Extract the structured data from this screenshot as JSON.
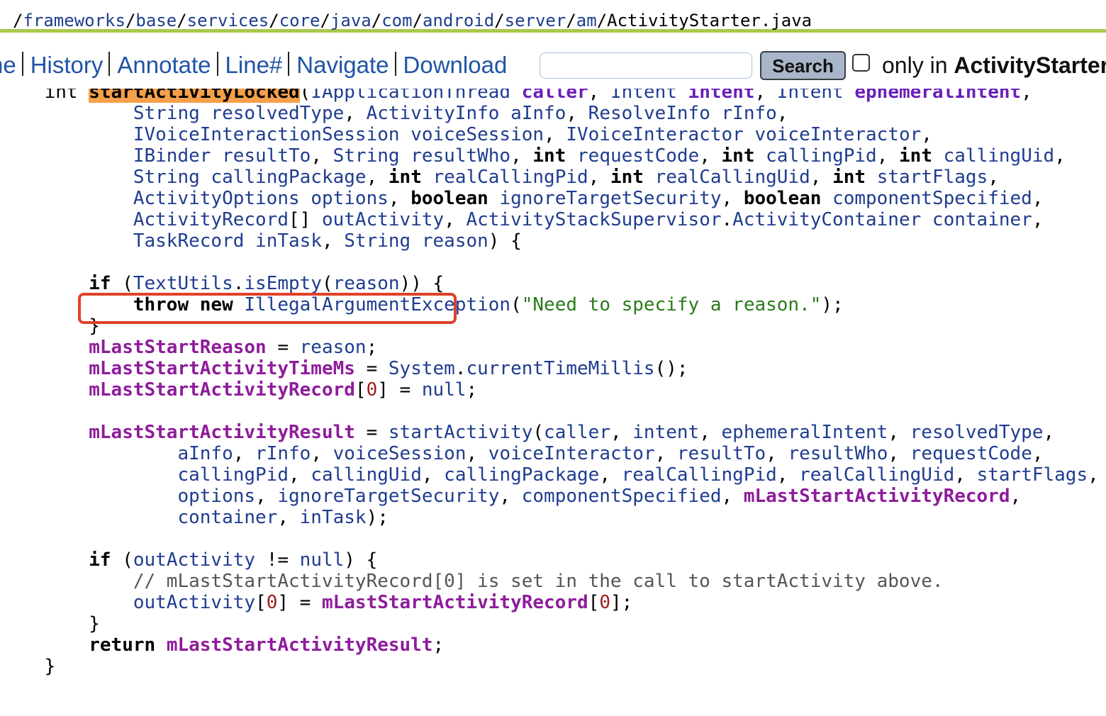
{
  "path": {
    "prefix": "/",
    "segments": [
      "frameworks",
      "base",
      "services",
      "core",
      "java",
      "com",
      "android",
      "server",
      "am"
    ],
    "separator": "/",
    "filename": "ActivityStarter.java"
  },
  "nav": {
    "links": [
      "ne",
      "History",
      "Annotate",
      "Line#",
      "Navigate",
      "Download"
    ],
    "search_placeholder": "",
    "search_button": "Search",
    "only_in_prefix": "only in ",
    "only_in_file": "ActivityStarter"
  },
  "highlight": {
    "border_color": "#e0412a",
    "symbol_bg": "#f5a04b"
  },
  "code": [
    [
      [
        "t",
        "    int "
      ],
      [
        "hl",
        "startActivityLocked"
      ],
      [
        "t",
        "("
      ],
      [
        "typ",
        "IApplicationThread"
      ],
      [
        "t",
        " "
      ],
      [
        "par",
        "caller"
      ],
      [
        "t",
        ", "
      ],
      [
        "typ",
        "Intent"
      ],
      [
        "t",
        " "
      ],
      [
        "par",
        "intent"
      ],
      [
        "t",
        ", "
      ],
      [
        "typ",
        "Intent"
      ],
      [
        "t",
        " "
      ],
      [
        "par",
        "ephemeralIntent"
      ],
      [
        "t",
        ","
      ]
    ],
    [
      [
        "t",
        "            "
      ],
      [
        "typ",
        "String"
      ],
      [
        "t",
        " "
      ],
      [
        "id",
        "resolvedType"
      ],
      [
        "t",
        ", "
      ],
      [
        "typ",
        "ActivityInfo"
      ],
      [
        "t",
        " "
      ],
      [
        "id",
        "aInfo"
      ],
      [
        "t",
        ", "
      ],
      [
        "typ",
        "ResolveInfo"
      ],
      [
        "t",
        " "
      ],
      [
        "id",
        "rInfo"
      ],
      [
        "t",
        ","
      ]
    ],
    [
      [
        "t",
        "            "
      ],
      [
        "typ",
        "IVoiceInteractionSession"
      ],
      [
        "t",
        " "
      ],
      [
        "id",
        "voiceSession"
      ],
      [
        "t",
        ", "
      ],
      [
        "typ",
        "IVoiceInteractor"
      ],
      [
        "t",
        " "
      ],
      [
        "id",
        "voiceInteractor"
      ],
      [
        "t",
        ","
      ]
    ],
    [
      [
        "t",
        "            "
      ],
      [
        "typ",
        "IBinder"
      ],
      [
        "t",
        " "
      ],
      [
        "id",
        "resultTo"
      ],
      [
        "t",
        ", "
      ],
      [
        "typ",
        "String"
      ],
      [
        "t",
        " "
      ],
      [
        "id",
        "resultWho"
      ],
      [
        "t",
        ", "
      ],
      [
        "kw",
        "int"
      ],
      [
        "t",
        " "
      ],
      [
        "id",
        "requestCode"
      ],
      [
        "t",
        ", "
      ],
      [
        "kw",
        "int"
      ],
      [
        "t",
        " "
      ],
      [
        "id",
        "callingPid"
      ],
      [
        "t",
        ", "
      ],
      [
        "kw",
        "int"
      ],
      [
        "t",
        " "
      ],
      [
        "id",
        "callingUid"
      ],
      [
        "t",
        ","
      ]
    ],
    [
      [
        "t",
        "            "
      ],
      [
        "typ",
        "String"
      ],
      [
        "t",
        " "
      ],
      [
        "id",
        "callingPackage"
      ],
      [
        "t",
        ", "
      ],
      [
        "kw",
        "int"
      ],
      [
        "t",
        " "
      ],
      [
        "id",
        "realCallingPid"
      ],
      [
        "t",
        ", "
      ],
      [
        "kw",
        "int"
      ],
      [
        "t",
        " "
      ],
      [
        "id",
        "realCallingUid"
      ],
      [
        "t",
        ", "
      ],
      [
        "kw",
        "int"
      ],
      [
        "t",
        " "
      ],
      [
        "id",
        "startFlags"
      ],
      [
        "t",
        ","
      ]
    ],
    [
      [
        "t",
        "            "
      ],
      [
        "typ",
        "ActivityOptions"
      ],
      [
        "t",
        " "
      ],
      [
        "id",
        "options"
      ],
      [
        "t",
        ", "
      ],
      [
        "kw",
        "boolean"
      ],
      [
        "t",
        " "
      ],
      [
        "id",
        "ignoreTargetSecurity"
      ],
      [
        "t",
        ", "
      ],
      [
        "kw",
        "boolean"
      ],
      [
        "t",
        " "
      ],
      [
        "id",
        "componentSpecified"
      ],
      [
        "t",
        ","
      ]
    ],
    [
      [
        "t",
        "            "
      ],
      [
        "typ",
        "ActivityRecord"
      ],
      [
        "t",
        "[] "
      ],
      [
        "id",
        "outActivity"
      ],
      [
        "t",
        ", "
      ],
      [
        "typ",
        "ActivityStackSupervisor"
      ],
      [
        "t",
        "."
      ],
      [
        "typ",
        "ActivityContainer"
      ],
      [
        "t",
        " "
      ],
      [
        "id",
        "container"
      ],
      [
        "t",
        ","
      ]
    ],
    [
      [
        "t",
        "            "
      ],
      [
        "typ",
        "TaskRecord"
      ],
      [
        "t",
        " "
      ],
      [
        "id",
        "inTask"
      ],
      [
        "t",
        ", "
      ],
      [
        "typ",
        "String"
      ],
      [
        "t",
        " "
      ],
      [
        "id",
        "reason"
      ],
      [
        "t",
        ") {"
      ]
    ],
    [],
    [
      [
        "t",
        "        "
      ],
      [
        "kw",
        "if"
      ],
      [
        "t",
        " ("
      ],
      [
        "typ",
        "TextUtils"
      ],
      [
        "t",
        "."
      ],
      [
        "id",
        "isEmpty"
      ],
      [
        "t",
        "("
      ],
      [
        "id",
        "reason"
      ],
      [
        "t",
        ")) {"
      ]
    ],
    [
      [
        "t",
        "            "
      ],
      [
        "kw",
        "throw"
      ],
      [
        "t",
        " "
      ],
      [
        "kw",
        "new"
      ],
      [
        "t",
        " "
      ],
      [
        "typ",
        "IllegalArgumentException"
      ],
      [
        "t",
        "("
      ],
      [
        "str",
        "\"Need to specify a reason.\""
      ],
      [
        "t",
        ");"
      ]
    ],
    [
      [
        "t",
        "        }"
      ]
    ],
    [
      [
        "t",
        "        "
      ],
      [
        "fld",
        "mLastStartReason"
      ],
      [
        "t",
        " = "
      ],
      [
        "id",
        "reason"
      ],
      [
        "t",
        ";"
      ]
    ],
    [
      [
        "t",
        "        "
      ],
      [
        "fld",
        "mLastStartActivityTimeMs"
      ],
      [
        "t",
        " = "
      ],
      [
        "typ",
        "System"
      ],
      [
        "t",
        "."
      ],
      [
        "id",
        "currentTimeMillis"
      ],
      [
        "t",
        "();"
      ]
    ],
    [
      [
        "t",
        "        "
      ],
      [
        "fld",
        "mLastStartActivityRecord"
      ],
      [
        "t",
        "["
      ],
      [
        "num",
        "0"
      ],
      [
        "t",
        "] = "
      ],
      [
        "id",
        "null"
      ],
      [
        "t",
        ";"
      ]
    ],
    [],
    [
      [
        "t",
        "        "
      ],
      [
        "fld",
        "mLastStartActivityResult"
      ],
      [
        "t",
        " = "
      ],
      [
        "id",
        "startActivity"
      ],
      [
        "t",
        "("
      ],
      [
        "id",
        "caller"
      ],
      [
        "t",
        ", "
      ],
      [
        "id",
        "intent"
      ],
      [
        "t",
        ", "
      ],
      [
        "id",
        "ephemeralIntent"
      ],
      [
        "t",
        ", "
      ],
      [
        "id",
        "resolvedType"
      ],
      [
        "t",
        ","
      ]
    ],
    [
      [
        "t",
        "                "
      ],
      [
        "id",
        "aInfo"
      ],
      [
        "t",
        ", "
      ],
      [
        "id",
        "rInfo"
      ],
      [
        "t",
        ", "
      ],
      [
        "id",
        "voiceSession"
      ],
      [
        "t",
        ", "
      ],
      [
        "id",
        "voiceInteractor"
      ],
      [
        "t",
        ", "
      ],
      [
        "id",
        "resultTo"
      ],
      [
        "t",
        ", "
      ],
      [
        "id",
        "resultWho"
      ],
      [
        "t",
        ", "
      ],
      [
        "id",
        "requestCode"
      ],
      [
        "t",
        ","
      ]
    ],
    [
      [
        "t",
        "                "
      ],
      [
        "id",
        "callingPid"
      ],
      [
        "t",
        ", "
      ],
      [
        "id",
        "callingUid"
      ],
      [
        "t",
        ", "
      ],
      [
        "id",
        "callingPackage"
      ],
      [
        "t",
        ", "
      ],
      [
        "id",
        "realCallingPid"
      ],
      [
        "t",
        ", "
      ],
      [
        "id",
        "realCallingUid"
      ],
      [
        "t",
        ", "
      ],
      [
        "id",
        "startFlags"
      ],
      [
        "t",
        ","
      ]
    ],
    [
      [
        "t",
        "                "
      ],
      [
        "id",
        "options"
      ],
      [
        "t",
        ", "
      ],
      [
        "id",
        "ignoreTargetSecurity"
      ],
      [
        "t",
        ", "
      ],
      [
        "id",
        "componentSpecified"
      ],
      [
        "t",
        ", "
      ],
      [
        "fld",
        "mLastStartActivityRecord"
      ],
      [
        "t",
        ","
      ]
    ],
    [
      [
        "t",
        "                "
      ],
      [
        "id",
        "container"
      ],
      [
        "t",
        ", "
      ],
      [
        "id",
        "inTask"
      ],
      [
        "t",
        ");"
      ]
    ],
    [],
    [
      [
        "t",
        "        "
      ],
      [
        "kw",
        "if"
      ],
      [
        "t",
        " ("
      ],
      [
        "id",
        "outActivity"
      ],
      [
        "t",
        " != "
      ],
      [
        "id",
        "null"
      ],
      [
        "t",
        ") {"
      ]
    ],
    [
      [
        "t",
        "            "
      ],
      [
        "com",
        "// mLastStartActivityRecord[0] is set in the call to startActivity above."
      ]
    ],
    [
      [
        "t",
        "            "
      ],
      [
        "id",
        "outActivity"
      ],
      [
        "t",
        "["
      ],
      [
        "num",
        "0"
      ],
      [
        "t",
        "] = "
      ],
      [
        "fld",
        "mLastStartActivityRecord"
      ],
      [
        "t",
        "["
      ],
      [
        "num",
        "0"
      ],
      [
        "t",
        "];"
      ]
    ],
    [
      [
        "t",
        "        }"
      ]
    ],
    [
      [
        "t",
        "        "
      ],
      [
        "kw",
        "return"
      ],
      [
        "t",
        " "
      ],
      [
        "fld",
        "mLastStartActivityResult"
      ],
      [
        "t",
        ";"
      ]
    ],
    [
      [
        "t",
        "    }"
      ]
    ]
  ]
}
